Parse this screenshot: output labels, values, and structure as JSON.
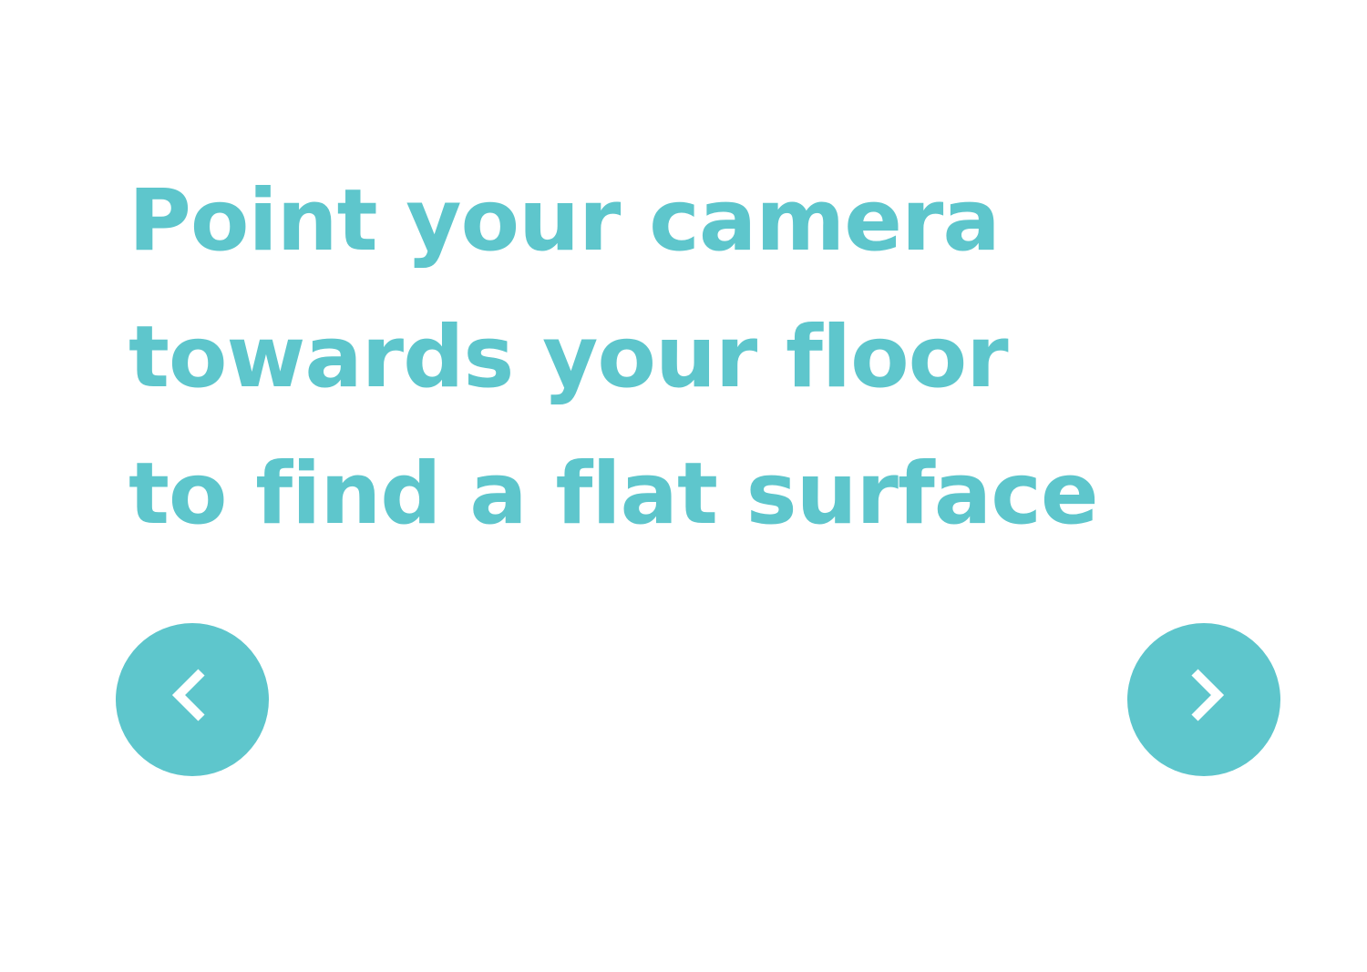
{
  "instruction": {
    "lines": [
      "Point your camera",
      "towards your floor",
      "to find a flat surface"
    ]
  },
  "navigation": {
    "prev_icon": "chevron-left-icon",
    "next_icon": "chevron-right-icon"
  },
  "colors": {
    "accent": "#5ec6cc",
    "background": "#ffffff",
    "icon": "#ffffff"
  }
}
